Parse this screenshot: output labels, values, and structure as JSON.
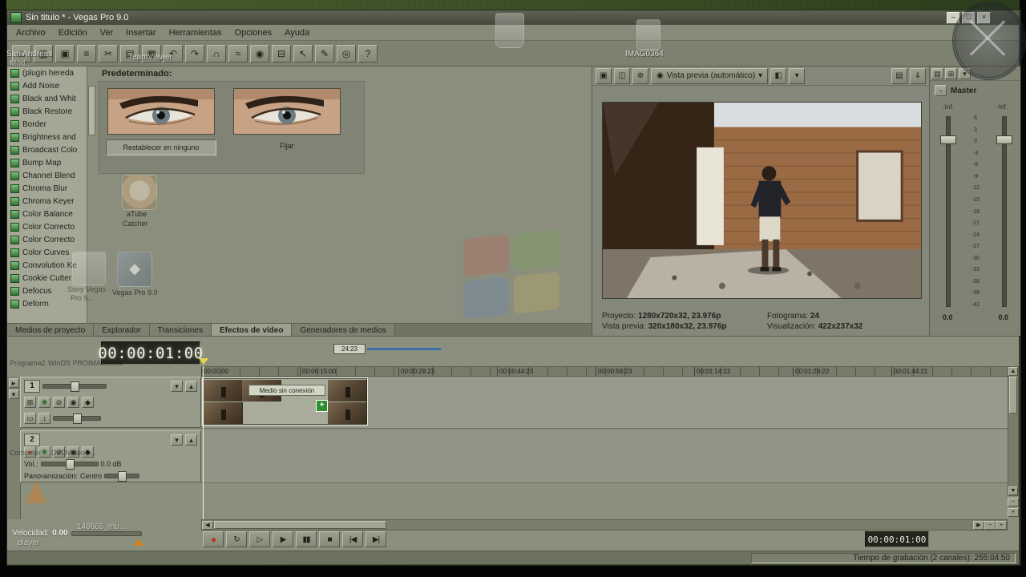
{
  "window": {
    "title": "Sin titulo * - Vegas Pro 9.0",
    "minimize": "–",
    "maximize": "□",
    "close": "×"
  },
  "menu": {
    "items": [
      "Archivo",
      "Edición",
      "Ver",
      "Insertar",
      "Herramientas",
      "Opciones",
      "Ayuda"
    ]
  },
  "toolbar": {
    "icons": [
      {
        "name": "new-project-icon",
        "glyph": "□"
      },
      {
        "name": "open-icon",
        "glyph": "▥"
      },
      {
        "name": "save-icon",
        "glyph": "▣"
      },
      {
        "name": "project-properties-icon",
        "glyph": "≡"
      },
      {
        "name": "cut-icon",
        "glyph": "✂"
      },
      {
        "name": "copy-icon",
        "glyph": "▤"
      },
      {
        "name": "paste-icon",
        "glyph": "▦"
      },
      {
        "name": "undo-icon",
        "glyph": "↶"
      },
      {
        "name": "redo-icon",
        "glyph": "↷"
      },
      {
        "name": "enable-snapping-icon",
        "glyph": "∩"
      },
      {
        "name": "auto-ripple-icon",
        "glyph": "≈"
      },
      {
        "name": "lock-envelopes-icon",
        "glyph": "◉"
      },
      {
        "name": "ignore-grouping-icon",
        "glyph": "⊟"
      },
      {
        "name": "normal-edit-tool-icon",
        "glyph": "↖"
      },
      {
        "name": "envelope-tool-icon",
        "glyph": "✎"
      },
      {
        "name": "zoom-tool-icon",
        "glyph": "◎"
      },
      {
        "name": "help-icon",
        "glyph": "?"
      }
    ]
  },
  "plugin_panel": {
    "items": [
      "(plugin hereda",
      "Add Noise",
      "Black and Whit",
      "Black Restore",
      "Border",
      "Brightness and",
      "Broadcast Colo",
      "Bump Map",
      "Channel Blend",
      "Chroma Blur",
      "Chroma Keyer",
      "Color Balance",
      "Color Correcto",
      "Color Correcto",
      "Color Curves",
      "Convolution Ke",
      "Cookie Cutter",
      "Defocus",
      "Deform"
    ]
  },
  "effects_panel": {
    "header": "Predeterminado:",
    "presets": [
      {
        "label": "Restablecer en ninguno"
      },
      {
        "label": "Fijar"
      }
    ]
  },
  "tabs": {
    "items": [
      {
        "label": "Medios de proyecto"
      },
      {
        "label": "Explorador"
      },
      {
        "label": "Transiciones"
      },
      {
        "label": "Efectos de vídeo",
        "active": true
      },
      {
        "label": "Generadores de medios"
      }
    ]
  },
  "preview": {
    "icons_left": [
      {
        "name": "preview-device-icon",
        "glyph": "▣"
      },
      {
        "name": "external-monitor-icon",
        "glyph": "◫"
      },
      {
        "name": "overlays-icon",
        "glyph": "⊕"
      }
    ],
    "quality_icon_glyph": "◉",
    "dropdown_label": "Vista previa (automático)",
    "dropdown_arrow": "▾",
    "icons_mid": [
      {
        "name": "split-screen-icon",
        "glyph": "◧"
      },
      {
        "name": "split-screen-arrow-icon",
        "glyph": "▾"
      }
    ],
    "icons_right": [
      {
        "name": "copy-snapshot-icon",
        "glyph": "▤"
      },
      {
        "name": "save-snapshot-icon",
        "glyph": "⇓"
      }
    ],
    "info": {
      "project_label": "Proyecto:",
      "project_value": "1280x720x32, 23.976p",
      "frame_label": "Fotograma:",
      "frame_value": "24",
      "preview_label": "Vista previa:",
      "preview_value": "320x180x32, 23.976p",
      "display_label": "Visualización:",
      "display_value": "422x237x32"
    }
  },
  "mixer": {
    "header_icons": [
      {
        "name": "mixer-insert-icon",
        "glyph": "▤"
      },
      {
        "name": "mixer-properties-icon",
        "glyph": "⊞"
      },
      {
        "name": "mixer-menu-icon",
        "glyph": "▾"
      }
    ],
    "master_icon_glyph": "▫",
    "title": "Master",
    "peak_left": "-Inf.",
    "peak_right": "-Inf.",
    "scale": [
      "6",
      "3",
      "0",
      "-3",
      "-6",
      "-9",
      "-12",
      "-15",
      "-18",
      "-21",
      "-24",
      "-27",
      "-30",
      "-33",
      "-36",
      "-39",
      "-42"
    ],
    "fader_left_db": "0.0",
    "fader_right_db": "0.0"
  },
  "timeline": {
    "timecode": "00:00:01:00",
    "selection_value": "24:23",
    "ruler": [
      "00:00:00",
      "00:00:15:00",
      "00:00:29:23",
      "00:00:44:23",
      "00:00:59:23",
      "00:01:14:22",
      "00:01:29:22",
      "00:01:44:21"
    ],
    "clip_label": "Medio sin conexión",
    "track1": {
      "number": "1",
      "buttons": [
        {
          "name": "track-motion-button",
          "glyph": "⊞"
        },
        {
          "name": "track-fx-button",
          "glyph": "✱",
          "cls": "fx"
        },
        {
          "name": "mute-button",
          "glyph": "⊘"
        },
        {
          "name": "solo-button",
          "glyph": "◉"
        },
        {
          "name": "automation-button",
          "glyph": "◆"
        }
      ]
    },
    "track2": {
      "number": "2",
      "vol_label": "Vol.:",
      "vol_value": "0.0 dB",
      "pan_label": "Panoramización:",
      "pan_value": "Centro",
      "buttons": [
        {
          "name": "arm-record-button",
          "glyph": "●",
          "cls": "rec"
        },
        {
          "name": "track-fx-button",
          "glyph": "✱",
          "cls": "fx"
        },
        {
          "name": "mute-button",
          "glyph": "⊘"
        },
        {
          "name": "solo-button",
          "glyph": "◉"
        },
        {
          "name": "automation-button",
          "glyph": "◆"
        }
      ]
    },
    "scrub_label": "Velocidad:",
    "scrub_value": "0.00"
  },
  "transport": {
    "buttons": [
      {
        "name": "record-button",
        "glyph": "●",
        "cls": "rec"
      },
      {
        "name": "loop-playback-button",
        "glyph": "↻"
      },
      {
        "name": "play-from-start-button",
        "glyph": "▷"
      },
      {
        "name": "play-button",
        "glyph": "▶"
      },
      {
        "name": "pause-button",
        "glyph": "▮▮"
      },
      {
        "name": "stop-button",
        "glyph": "■"
      },
      {
        "name": "go-to-start-button",
        "glyph": "|◀"
      },
      {
        "name": "go-to-end-button",
        "glyph": "▶|"
      }
    ]
  },
  "status": {
    "timecode": "00:00:01:00",
    "recording_info": "Tiempo de grabación (2 canales): 255:04:50"
  },
  "desktop": {
    "labels": {
      "san_andreas": "San Andreas",
      "mod": "Mod...",
      "teamviewer": "TeamViewer",
      "imag_top": "IMAG0364",
      "atube1": "aTube",
      "atube2": "Catcher",
      "sony1": "Sony Vegas",
      "sony2": "Pro 9...",
      "vegas": "Vegas Pro 9.0",
      "programa2": "Programa2",
      "winds": "WinDS PRO",
      "imag_mid": "IMAG0364",
      "computer": "Computer",
      "dvd": "DVDVideoS...",
      "music": "148665_mu...",
      "player": "player"
    }
  },
  "colors": {
    "accent_blue": "#3a6ea5",
    "record_red": "#b8382a",
    "fx_green": "#2f6e2f",
    "marker_orange": "#d8821e",
    "playhead_yellow": "#e8d44a"
  }
}
